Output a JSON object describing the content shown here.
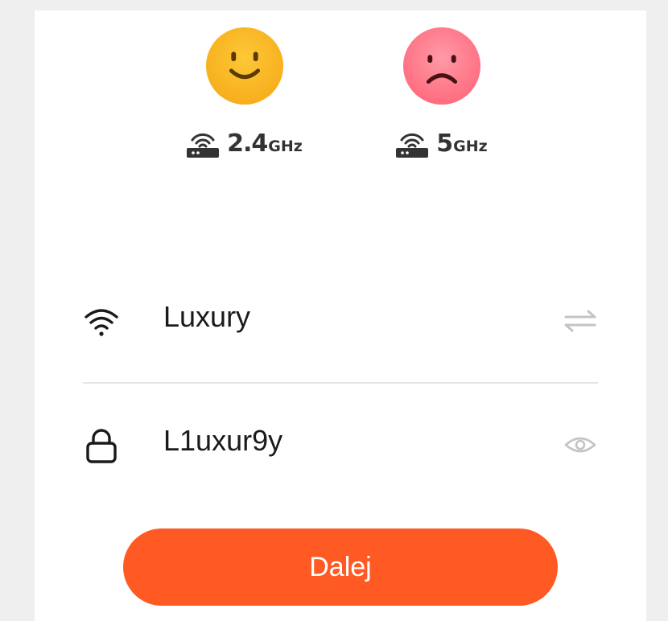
{
  "bands": [
    {
      "number": "2.4",
      "unit": "GHz",
      "status": "good",
      "face_color": "#fbb829"
    },
    {
      "number": "5",
      "unit": "GHz",
      "status": "bad",
      "face_color": "#ff7a8a"
    }
  ],
  "network": {
    "ssid": "Luxury",
    "password": "L1uxur9y"
  },
  "icons": {
    "ssid": "wifi-icon",
    "password": "lock-icon",
    "switch": "swap-arrows-icon",
    "reveal": "eye-icon",
    "router": "router-icon"
  },
  "actions": {
    "next_label": "Dalej"
  },
  "colors": {
    "accent": "#ff5a23",
    "good": "#fbb829",
    "bad": "#ff7a8a",
    "icon_gray": "#c4c4c4"
  }
}
